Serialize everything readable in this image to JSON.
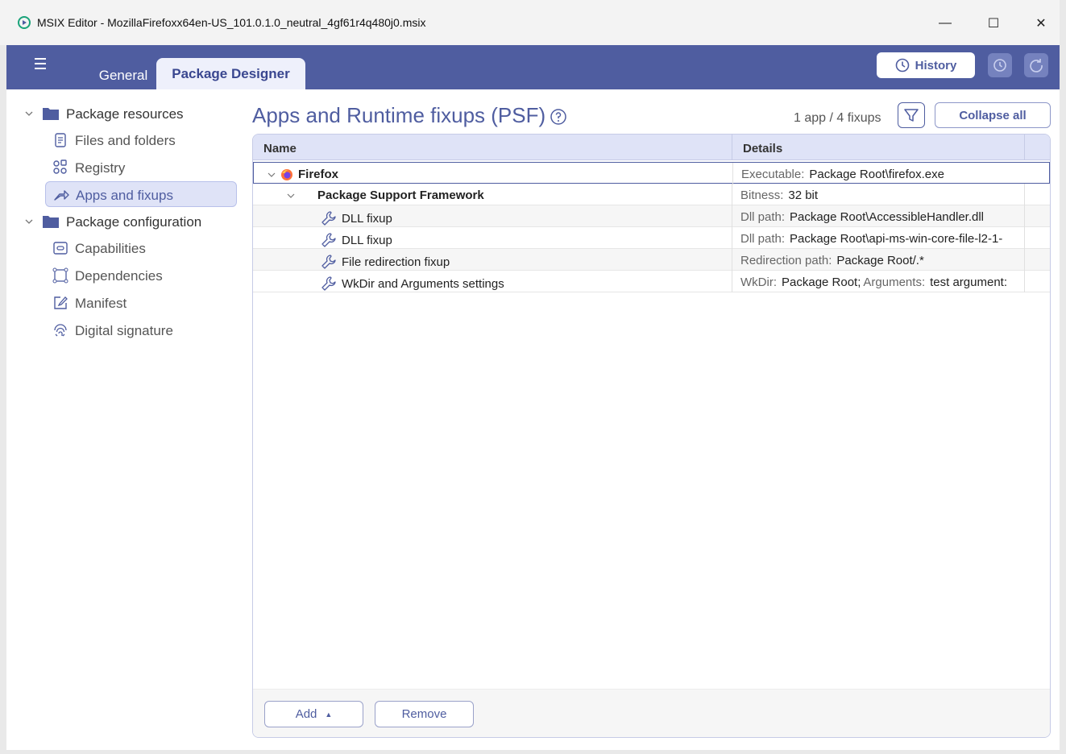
{
  "window": {
    "title": "MSIX Editor - MozillaFirefoxx64en-US_101.0.1.0_neutral_4gf61r4q480j0.msix",
    "minimize_glyph": "—",
    "maximize_glyph": "☐",
    "close_glyph": "✕"
  },
  "header": {
    "tabs": [
      {
        "label": "General",
        "active": false
      },
      {
        "label": "Package Designer",
        "active": true
      }
    ],
    "history_label": "History",
    "accent_color": "#4f5da0"
  },
  "sidebar": {
    "groups": [
      {
        "label": "Package resources",
        "items": [
          {
            "label": "Files and folders",
            "icon": "file-icon"
          },
          {
            "label": "Registry",
            "icon": "registry-icon"
          },
          {
            "label": "Apps and fixups",
            "icon": "share-arrow-icon",
            "active": true
          }
        ]
      },
      {
        "label": "Package configuration",
        "items": [
          {
            "label": "Capabilities",
            "icon": "capability-icon"
          },
          {
            "label": "Dependencies",
            "icon": "dependencies-icon"
          },
          {
            "label": "Manifest",
            "icon": "edit-icon"
          },
          {
            "label": "Digital signature",
            "icon": "fingerprint-icon"
          }
        ]
      }
    ]
  },
  "main": {
    "title": "Apps and Runtime fixups (PSF)",
    "count": "1 app / 4 fixups",
    "collapse_all_label": "Collapse all",
    "columns": {
      "name": "Name",
      "details": "Details"
    },
    "rows": [
      {
        "name": "Firefox",
        "key": "Executable:",
        "value": "Package Root\\firefox.exe"
      },
      {
        "name": "Package Support Framework",
        "key": "Bitness:",
        "value": "32 bit"
      },
      {
        "name": "DLL fixup",
        "key": "Dll path:",
        "value": "Package Root\\AccessibleHandler.dll"
      },
      {
        "name": "DLL fixup",
        "key": "Dll path:",
        "value": "Package Root\\api-ms-win-core-file-l2-1-"
      },
      {
        "name": "File redirection fixup",
        "key": "Redirection path:",
        "value": "Package Root/.*"
      },
      {
        "name": "WkDir and Arguments settings",
        "key": "WkDir:",
        "value": "Package Root;",
        "key2": "Arguments:",
        "value2": "test argument:"
      }
    ],
    "add_label": "Add",
    "add_caret": "▲",
    "remove_label": "Remove"
  }
}
